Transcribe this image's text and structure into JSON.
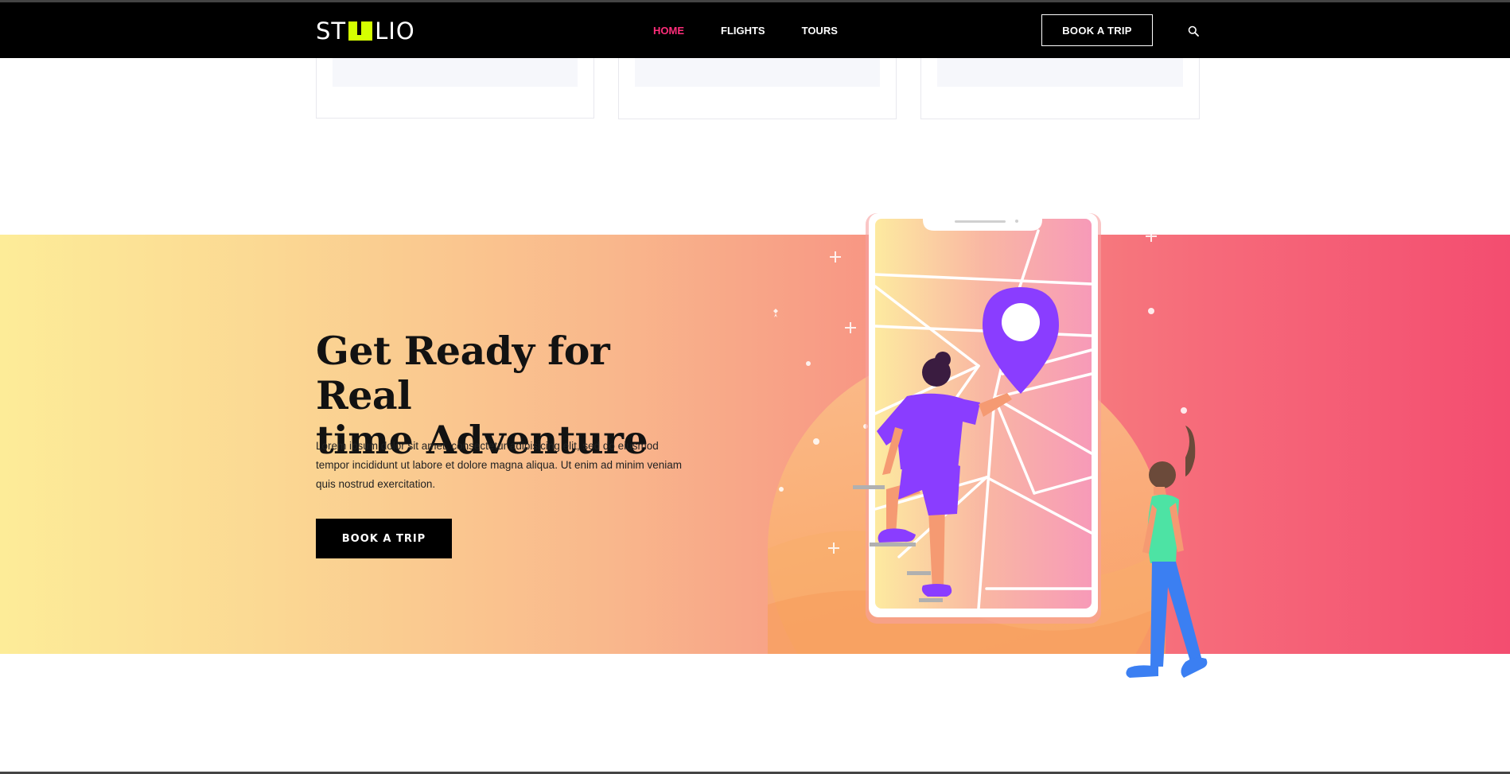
{
  "header": {
    "logo_text_left": "ST",
    "logo_text_right": "LIO",
    "nav": [
      {
        "label": "HOME",
        "active": true
      },
      {
        "label": "FLIGHTS",
        "active": false
      },
      {
        "label": "TOURS",
        "active": false
      }
    ],
    "book_button_label": "BOOK A TRIP",
    "search_icon": "search-icon"
  },
  "hero": {
    "headline_line1": "Get Ready for Real",
    "headline_line2": "time Adventure",
    "paragraph": "Lorem ipsum dolor sit amet, consectetur adipisicing elit, sed do eiusmod tempor incididunt ut labore et dolore magna aliqua. Ut enim ad minim veniam quis nostrud exercitation.",
    "button_label": "BOOK A TRIP"
  },
  "colors": {
    "accent": "#ff2d7a",
    "logo_mark": "#d4ff00",
    "gradient_start": "#fdec98",
    "gradient_end": "#f34d70",
    "pin": "#8a3dff"
  }
}
